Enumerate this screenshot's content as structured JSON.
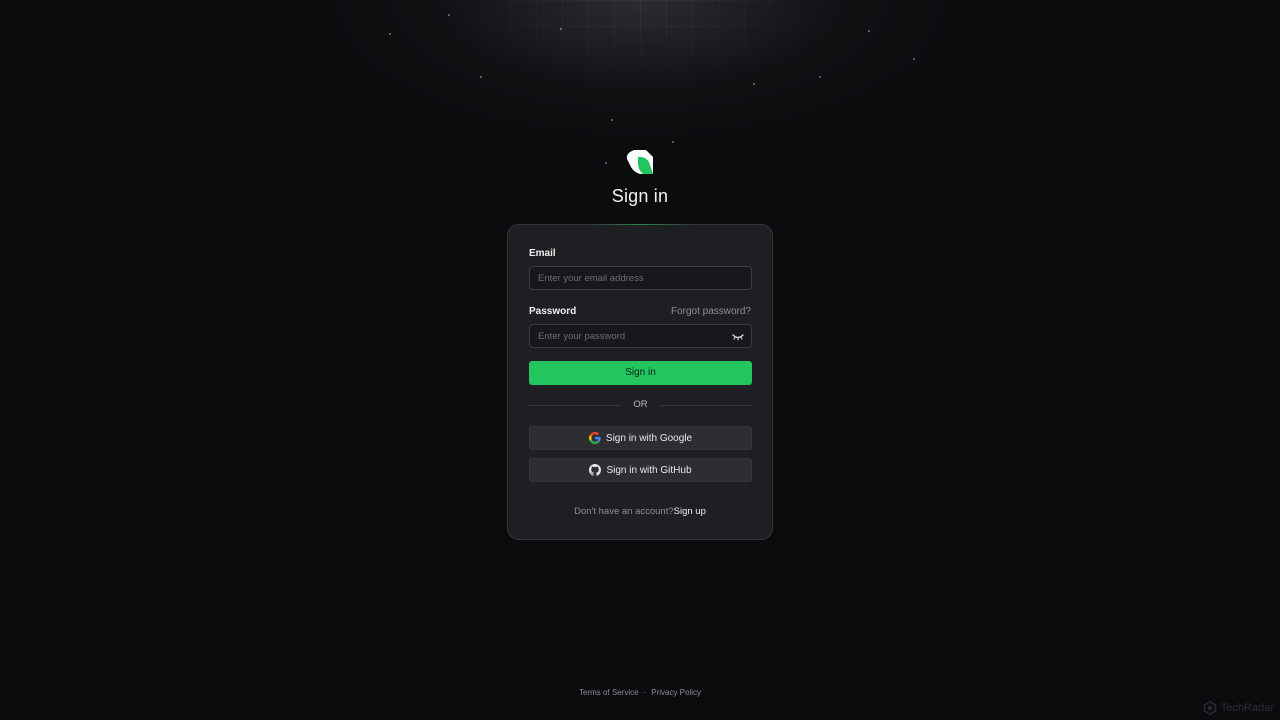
{
  "header": {
    "title": "Sign in"
  },
  "form": {
    "email_label": "Email",
    "email_placeholder": "Enter your email address",
    "email_value": "",
    "password_label": "Password",
    "forgot_password": "Forgot password?",
    "password_placeholder": "Enter your password",
    "password_value": "",
    "submit_label": "Sign in",
    "divider_text": "OR",
    "google_label": "Sign in with Google",
    "github_label": "Sign in with GitHub",
    "no_account_text": "Don't have an account?",
    "signup_link": "Sign up"
  },
  "footer": {
    "terms": "Terms of Service",
    "separator": "·",
    "privacy": "Privacy Policy"
  },
  "watermark": {
    "text": "TechRadar"
  },
  "icons": {
    "logo": "app-logo-icon",
    "password_toggle": "eye-closed-icon",
    "google": "google-icon",
    "github": "github-icon"
  },
  "colors": {
    "accent": "#22c55e",
    "background": "#0b0c0e",
    "card": "#1e1f22"
  }
}
